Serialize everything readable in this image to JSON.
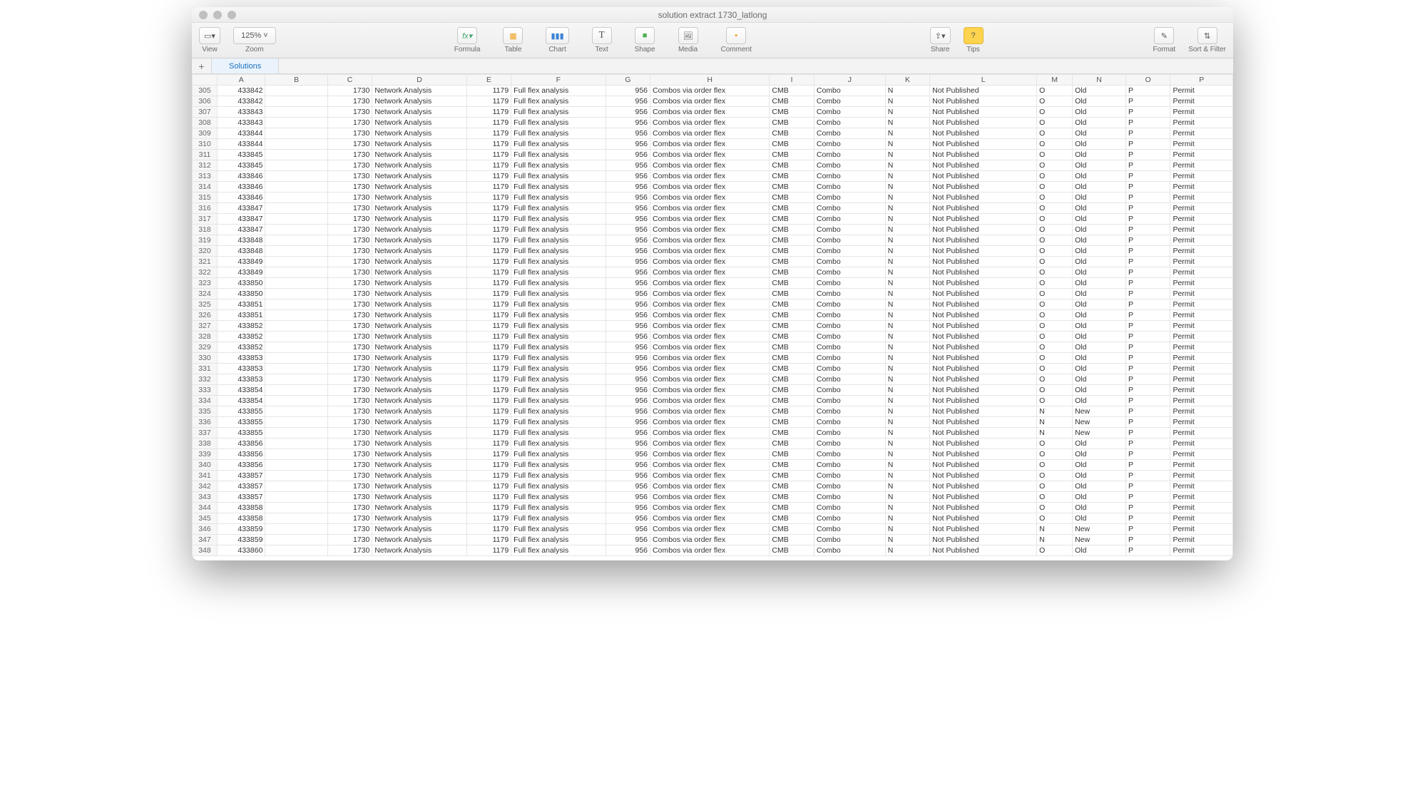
{
  "window": {
    "title": "solution extract 1730_latlong"
  },
  "toolbar": {
    "view_label": "View",
    "zoom_label": "Zoom",
    "zoom_value": "125%",
    "formula_label": "Formula",
    "table_label": "Table",
    "chart_label": "Chart",
    "text_label": "Text",
    "shape_label": "Shape",
    "media_label": "Media",
    "comment_label": "Comment",
    "share_label": "Share",
    "tips_label": "Tips",
    "format_label": "Format",
    "sort_label": "Sort & Filter"
  },
  "sheet": {
    "add_symbol": "+",
    "tab_name": "Solutions"
  },
  "columns": [
    "",
    "A",
    "B",
    "C",
    "D",
    "E",
    "F",
    "G",
    "H",
    "I",
    "J",
    "K",
    "L",
    "M",
    "N",
    "O",
    "P"
  ],
  "row_start": 305,
  "row_nums": [
    305,
    306,
    307,
    308,
    309,
    310,
    311,
    312,
    313,
    314,
    315,
    316,
    317,
    318,
    319,
    320,
    321,
    322,
    323,
    324,
    325,
    326,
    327,
    328,
    329,
    330,
    331,
    332,
    333,
    334,
    335,
    336,
    337,
    338,
    339,
    340,
    341,
    342,
    343,
    344,
    345,
    346,
    347,
    348
  ],
  "rows": [
    {
      "A": "433842",
      "C": "1730",
      "D": "Network Analysis",
      "E": "1179",
      "F": "Full flex analysis",
      "G": "956",
      "H": "Combos via order flex",
      "I": "CMB",
      "J": "Combo",
      "K": "N",
      "L": "Not Published",
      "M": "O",
      "N": "Old",
      "O": "P",
      "P": "Permit"
    },
    {
      "A": "433842",
      "C": "1730",
      "D": "Network Analysis",
      "E": "1179",
      "F": "Full flex analysis",
      "G": "956",
      "H": "Combos via order flex",
      "I": "CMB",
      "J": "Combo",
      "K": "N",
      "L": "Not Published",
      "M": "O",
      "N": "Old",
      "O": "P",
      "P": "Permit"
    },
    {
      "A": "433843",
      "C": "1730",
      "D": "Network Analysis",
      "E": "1179",
      "F": "Full flex analysis",
      "G": "956",
      "H": "Combos via order flex",
      "I": "CMB",
      "J": "Combo",
      "K": "N",
      "L": "Not Published",
      "M": "O",
      "N": "Old",
      "O": "P",
      "P": "Permit"
    },
    {
      "A": "433843",
      "C": "1730",
      "D": "Network Analysis",
      "E": "1179",
      "F": "Full flex analysis",
      "G": "956",
      "H": "Combos via order flex",
      "I": "CMB",
      "J": "Combo",
      "K": "N",
      "L": "Not Published",
      "M": "O",
      "N": "Old",
      "O": "P",
      "P": "Permit"
    },
    {
      "A": "433844",
      "C": "1730",
      "D": "Network Analysis",
      "E": "1179",
      "F": "Full flex analysis",
      "G": "956",
      "H": "Combos via order flex",
      "I": "CMB",
      "J": "Combo",
      "K": "N",
      "L": "Not Published",
      "M": "O",
      "N": "Old",
      "O": "P",
      "P": "Permit"
    },
    {
      "A": "433844",
      "C": "1730",
      "D": "Network Analysis",
      "E": "1179",
      "F": "Full flex analysis",
      "G": "956",
      "H": "Combos via order flex",
      "I": "CMB",
      "J": "Combo",
      "K": "N",
      "L": "Not Published",
      "M": "O",
      "N": "Old",
      "O": "P",
      "P": "Permit"
    },
    {
      "A": "433845",
      "C": "1730",
      "D": "Network Analysis",
      "E": "1179",
      "F": "Full flex analysis",
      "G": "956",
      "H": "Combos via order flex",
      "I": "CMB",
      "J": "Combo",
      "K": "N",
      "L": "Not Published",
      "M": "O",
      "N": "Old",
      "O": "P",
      "P": "Permit"
    },
    {
      "A": "433845",
      "C": "1730",
      "D": "Network Analysis",
      "E": "1179",
      "F": "Full flex analysis",
      "G": "956",
      "H": "Combos via order flex",
      "I": "CMB",
      "J": "Combo",
      "K": "N",
      "L": "Not Published",
      "M": "O",
      "N": "Old",
      "O": "P",
      "P": "Permit"
    },
    {
      "A": "433846",
      "C": "1730",
      "D": "Network Analysis",
      "E": "1179",
      "F": "Full flex analysis",
      "G": "956",
      "H": "Combos via order flex",
      "I": "CMB",
      "J": "Combo",
      "K": "N",
      "L": "Not Published",
      "M": "O",
      "N": "Old",
      "O": "P",
      "P": "Permit"
    },
    {
      "A": "433846",
      "C": "1730",
      "D": "Network Analysis",
      "E": "1179",
      "F": "Full flex analysis",
      "G": "956",
      "H": "Combos via order flex",
      "I": "CMB",
      "J": "Combo",
      "K": "N",
      "L": "Not Published",
      "M": "O",
      "N": "Old",
      "O": "P",
      "P": "Permit"
    },
    {
      "A": "433846",
      "C": "1730",
      "D": "Network Analysis",
      "E": "1179",
      "F": "Full flex analysis",
      "G": "956",
      "H": "Combos via order flex",
      "I": "CMB",
      "J": "Combo",
      "K": "N",
      "L": "Not Published",
      "M": "O",
      "N": "Old",
      "O": "P",
      "P": "Permit"
    },
    {
      "A": "433847",
      "C": "1730",
      "D": "Network Analysis",
      "E": "1179",
      "F": "Full flex analysis",
      "G": "956",
      "H": "Combos via order flex",
      "I": "CMB",
      "J": "Combo",
      "K": "N",
      "L": "Not Published",
      "M": "O",
      "N": "Old",
      "O": "P",
      "P": "Permit"
    },
    {
      "A": "433847",
      "C": "1730",
      "D": "Network Analysis",
      "E": "1179",
      "F": "Full flex analysis",
      "G": "956",
      "H": "Combos via order flex",
      "I": "CMB",
      "J": "Combo",
      "K": "N",
      "L": "Not Published",
      "M": "O",
      "N": "Old",
      "O": "P",
      "P": "Permit"
    },
    {
      "A": "433847",
      "C": "1730",
      "D": "Network Analysis",
      "E": "1179",
      "F": "Full flex analysis",
      "G": "956",
      "H": "Combos via order flex",
      "I": "CMB",
      "J": "Combo",
      "K": "N",
      "L": "Not Published",
      "M": "O",
      "N": "Old",
      "O": "P",
      "P": "Permit"
    },
    {
      "A": "433848",
      "C": "1730",
      "D": "Network Analysis",
      "E": "1179",
      "F": "Full flex analysis",
      "G": "956",
      "H": "Combos via order flex",
      "I": "CMB",
      "J": "Combo",
      "K": "N",
      "L": "Not Published",
      "M": "O",
      "N": "Old",
      "O": "P",
      "P": "Permit"
    },
    {
      "A": "433848",
      "C": "1730",
      "D": "Network Analysis",
      "E": "1179",
      "F": "Full flex analysis",
      "G": "956",
      "H": "Combos via order flex",
      "I": "CMB",
      "J": "Combo",
      "K": "N",
      "L": "Not Published",
      "M": "O",
      "N": "Old",
      "O": "P",
      "P": "Permit"
    },
    {
      "A": "433849",
      "C": "1730",
      "D": "Network Analysis",
      "E": "1179",
      "F": "Full flex analysis",
      "G": "956",
      "H": "Combos via order flex",
      "I": "CMB",
      "J": "Combo",
      "K": "N",
      "L": "Not Published",
      "M": "O",
      "N": "Old",
      "O": "P",
      "P": "Permit"
    },
    {
      "A": "433849",
      "C": "1730",
      "D": "Network Analysis",
      "E": "1179",
      "F": "Full flex analysis",
      "G": "956",
      "H": "Combos via order flex",
      "I": "CMB",
      "J": "Combo",
      "K": "N",
      "L": "Not Published",
      "M": "O",
      "N": "Old",
      "O": "P",
      "P": "Permit"
    },
    {
      "A": "433850",
      "C": "1730",
      "D": "Network Analysis",
      "E": "1179",
      "F": "Full flex analysis",
      "G": "956",
      "H": "Combos via order flex",
      "I": "CMB",
      "J": "Combo",
      "K": "N",
      "L": "Not Published",
      "M": "O",
      "N": "Old",
      "O": "P",
      "P": "Permit"
    },
    {
      "A": "433850",
      "C": "1730",
      "D": "Network Analysis",
      "E": "1179",
      "F": "Full flex analysis",
      "G": "956",
      "H": "Combos via order flex",
      "I": "CMB",
      "J": "Combo",
      "K": "N",
      "L": "Not Published",
      "M": "O",
      "N": "Old",
      "O": "P",
      "P": "Permit"
    },
    {
      "A": "433851",
      "C": "1730",
      "D": "Network Analysis",
      "E": "1179",
      "F": "Full flex analysis",
      "G": "956",
      "H": "Combos via order flex",
      "I": "CMB",
      "J": "Combo",
      "K": "N",
      "L": "Not Published",
      "M": "O",
      "N": "Old",
      "O": "P",
      "P": "Permit"
    },
    {
      "A": "433851",
      "C": "1730",
      "D": "Network Analysis",
      "E": "1179",
      "F": "Full flex analysis",
      "G": "956",
      "H": "Combos via order flex",
      "I": "CMB",
      "J": "Combo",
      "K": "N",
      "L": "Not Published",
      "M": "O",
      "N": "Old",
      "O": "P",
      "P": "Permit"
    },
    {
      "A": "433852",
      "C": "1730",
      "D": "Network Analysis",
      "E": "1179",
      "F": "Full flex analysis",
      "G": "956",
      "H": "Combos via order flex",
      "I": "CMB",
      "J": "Combo",
      "K": "N",
      "L": "Not Published",
      "M": "O",
      "N": "Old",
      "O": "P",
      "P": "Permit"
    },
    {
      "A": "433852",
      "C": "1730",
      "D": "Network Analysis",
      "E": "1179",
      "F": "Full flex analysis",
      "G": "956",
      "H": "Combos via order flex",
      "I": "CMB",
      "J": "Combo",
      "K": "N",
      "L": "Not Published",
      "M": "O",
      "N": "Old",
      "O": "P",
      "P": "Permit"
    },
    {
      "A": "433852",
      "C": "1730",
      "D": "Network Analysis",
      "E": "1179",
      "F": "Full flex analysis",
      "G": "956",
      "H": "Combos via order flex",
      "I": "CMB",
      "J": "Combo",
      "K": "N",
      "L": "Not Published",
      "M": "O",
      "N": "Old",
      "O": "P",
      "P": "Permit"
    },
    {
      "A": "433853",
      "C": "1730",
      "D": "Network Analysis",
      "E": "1179",
      "F": "Full flex analysis",
      "G": "956",
      "H": "Combos via order flex",
      "I": "CMB",
      "J": "Combo",
      "K": "N",
      "L": "Not Published",
      "M": "O",
      "N": "Old",
      "O": "P",
      "P": "Permit"
    },
    {
      "A": "433853",
      "C": "1730",
      "D": "Network Analysis",
      "E": "1179",
      "F": "Full flex analysis",
      "G": "956",
      "H": "Combos via order flex",
      "I": "CMB",
      "J": "Combo",
      "K": "N",
      "L": "Not Published",
      "M": "O",
      "N": "Old",
      "O": "P",
      "P": "Permit"
    },
    {
      "A": "433853",
      "C": "1730",
      "D": "Network Analysis",
      "E": "1179",
      "F": "Full flex analysis",
      "G": "956",
      "H": "Combos via order flex",
      "I": "CMB",
      "J": "Combo",
      "K": "N",
      "L": "Not Published",
      "M": "O",
      "N": "Old",
      "O": "P",
      "P": "Permit"
    },
    {
      "A": "433854",
      "C": "1730",
      "D": "Network Analysis",
      "E": "1179",
      "F": "Full flex analysis",
      "G": "956",
      "H": "Combos via order flex",
      "I": "CMB",
      "J": "Combo",
      "K": "N",
      "L": "Not Published",
      "M": "O",
      "N": "Old",
      "O": "P",
      "P": "Permit"
    },
    {
      "A": "433854",
      "C": "1730",
      "D": "Network Analysis",
      "E": "1179",
      "F": "Full flex analysis",
      "G": "956",
      "H": "Combos via order flex",
      "I": "CMB",
      "J": "Combo",
      "K": "N",
      "L": "Not Published",
      "M": "O",
      "N": "Old",
      "O": "P",
      "P": "Permit"
    },
    {
      "A": "433855",
      "C": "1730",
      "D": "Network Analysis",
      "E": "1179",
      "F": "Full flex analysis",
      "G": "956",
      "H": "Combos via order flex",
      "I": "CMB",
      "J": "Combo",
      "K": "N",
      "L": "Not Published",
      "M": "N",
      "N": "New",
      "O": "P",
      "P": "Permit"
    },
    {
      "A": "433855",
      "C": "1730",
      "D": "Network Analysis",
      "E": "1179",
      "F": "Full flex analysis",
      "G": "956",
      "H": "Combos via order flex",
      "I": "CMB",
      "J": "Combo",
      "K": "N",
      "L": "Not Published",
      "M": "N",
      "N": "New",
      "O": "P",
      "P": "Permit"
    },
    {
      "A": "433855",
      "C": "1730",
      "D": "Network Analysis",
      "E": "1179",
      "F": "Full flex analysis",
      "G": "956",
      "H": "Combos via order flex",
      "I": "CMB",
      "J": "Combo",
      "K": "N",
      "L": "Not Published",
      "M": "N",
      "N": "New",
      "O": "P",
      "P": "Permit"
    },
    {
      "A": "433856",
      "C": "1730",
      "D": "Network Analysis",
      "E": "1179",
      "F": "Full flex analysis",
      "G": "956",
      "H": "Combos via order flex",
      "I": "CMB",
      "J": "Combo",
      "K": "N",
      "L": "Not Published",
      "M": "O",
      "N": "Old",
      "O": "P",
      "P": "Permit"
    },
    {
      "A": "433856",
      "C": "1730",
      "D": "Network Analysis",
      "E": "1179",
      "F": "Full flex analysis",
      "G": "956",
      "H": "Combos via order flex",
      "I": "CMB",
      "J": "Combo",
      "K": "N",
      "L": "Not Published",
      "M": "O",
      "N": "Old",
      "O": "P",
      "P": "Permit"
    },
    {
      "A": "433856",
      "C": "1730",
      "D": "Network Analysis",
      "E": "1179",
      "F": "Full flex analysis",
      "G": "956",
      "H": "Combos via order flex",
      "I": "CMB",
      "J": "Combo",
      "K": "N",
      "L": "Not Published",
      "M": "O",
      "N": "Old",
      "O": "P",
      "P": "Permit"
    },
    {
      "A": "433857",
      "C": "1730",
      "D": "Network Analysis",
      "E": "1179",
      "F": "Full flex analysis",
      "G": "956",
      "H": "Combos via order flex",
      "I": "CMB",
      "J": "Combo",
      "K": "N",
      "L": "Not Published",
      "M": "O",
      "N": "Old",
      "O": "P",
      "P": "Permit"
    },
    {
      "A": "433857",
      "C": "1730",
      "D": "Network Analysis",
      "E": "1179",
      "F": "Full flex analysis",
      "G": "956",
      "H": "Combos via order flex",
      "I": "CMB",
      "J": "Combo",
      "K": "N",
      "L": "Not Published",
      "M": "O",
      "N": "Old",
      "O": "P",
      "P": "Permit"
    },
    {
      "A": "433857",
      "C": "1730",
      "D": "Network Analysis",
      "E": "1179",
      "F": "Full flex analysis",
      "G": "956",
      "H": "Combos via order flex",
      "I": "CMB",
      "J": "Combo",
      "K": "N",
      "L": "Not Published",
      "M": "O",
      "N": "Old",
      "O": "P",
      "P": "Permit"
    },
    {
      "A": "433858",
      "C": "1730",
      "D": "Network Analysis",
      "E": "1179",
      "F": "Full flex analysis",
      "G": "956",
      "H": "Combos via order flex",
      "I": "CMB",
      "J": "Combo",
      "K": "N",
      "L": "Not Published",
      "M": "O",
      "N": "Old",
      "O": "P",
      "P": "Permit"
    },
    {
      "A": "433858",
      "C": "1730",
      "D": "Network Analysis",
      "E": "1179",
      "F": "Full flex analysis",
      "G": "956",
      "H": "Combos via order flex",
      "I": "CMB",
      "J": "Combo",
      "K": "N",
      "L": "Not Published",
      "M": "O",
      "N": "Old",
      "O": "P",
      "P": "Permit"
    },
    {
      "A": "433859",
      "C": "1730",
      "D": "Network Analysis",
      "E": "1179",
      "F": "Full flex analysis",
      "G": "956",
      "H": "Combos via order flex",
      "I": "CMB",
      "J": "Combo",
      "K": "N",
      "L": "Not Published",
      "M": "N",
      "N": "New",
      "O": "P",
      "P": "Permit"
    },
    {
      "A": "433859",
      "C": "1730",
      "D": "Network Analysis",
      "E": "1179",
      "F": "Full flex analysis",
      "G": "956",
      "H": "Combos via order flex",
      "I": "CMB",
      "J": "Combo",
      "K": "N",
      "L": "Not Published",
      "M": "N",
      "N": "New",
      "O": "P",
      "P": "Permit"
    },
    {
      "A": "433860",
      "C": "1730",
      "D": "Network Analysis",
      "E": "1179",
      "F": "Full flex analysis",
      "G": "956",
      "H": "Combos via order flex",
      "I": "CMB",
      "J": "Combo",
      "K": "N",
      "L": "Not Published",
      "M": "O",
      "N": "Old",
      "O": "P",
      "P": "Permit"
    }
  ]
}
